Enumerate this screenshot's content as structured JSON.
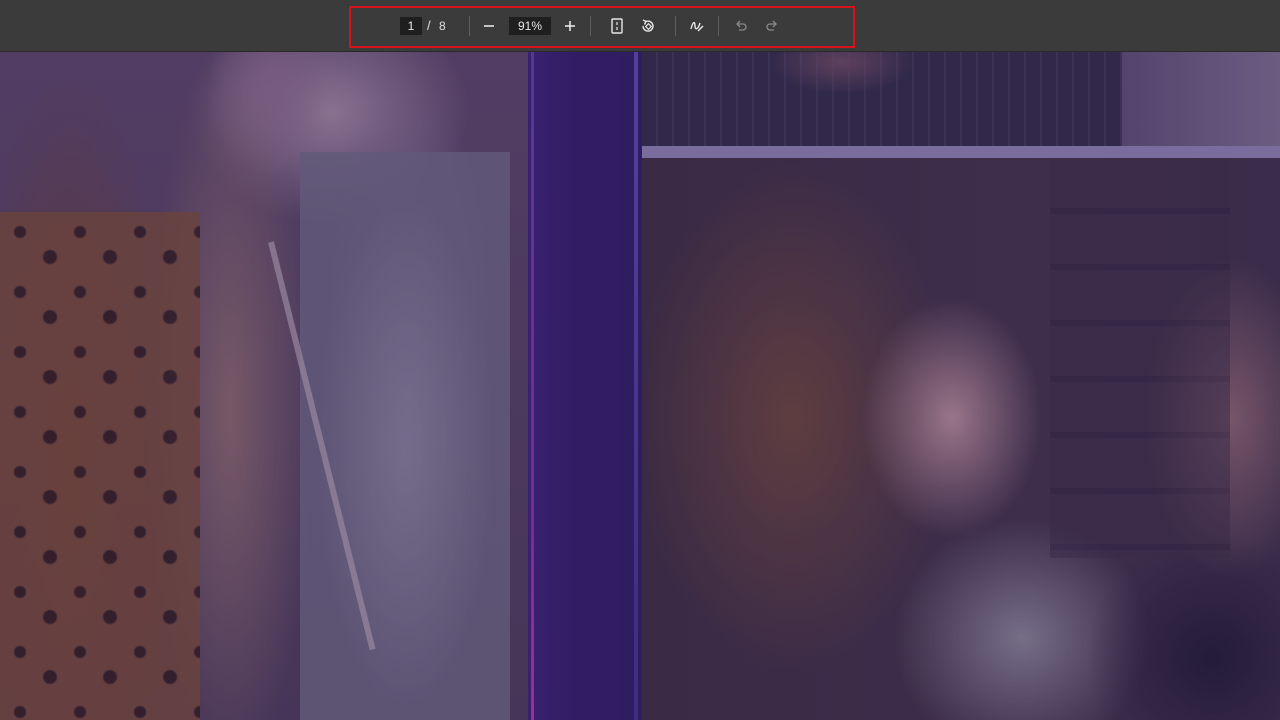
{
  "toolbar": {
    "page_current": "1",
    "page_separator": "/",
    "page_total": "8",
    "zoom_value": "91%",
    "icons": {
      "zoom_out": "minus-icon",
      "zoom_in": "plus-icon",
      "fit_page": "fit-page-icon",
      "rotate": "rotate-icon",
      "draw": "draw-icon",
      "undo": "undo-icon",
      "redo": "redo-icon"
    },
    "highlight_color": "#d7141a"
  },
  "document": {
    "accent_strip_color": "#2e1a62"
  }
}
